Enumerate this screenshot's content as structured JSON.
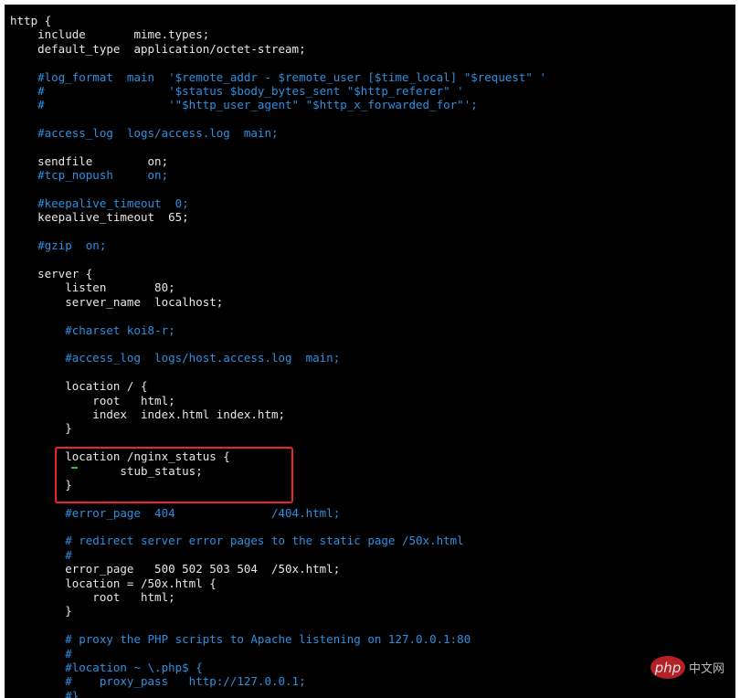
{
  "colors": {
    "background": "#000000",
    "text": "#e6e6e6",
    "comment": "#2f8fe0",
    "highlight": "#e8262a",
    "cursor": "#22c83a"
  },
  "lines": [
    {
      "text": "http {",
      "comment": false
    },
    {
      "text": "    include       mime.types;",
      "comment": false
    },
    {
      "text": "    default_type  application/octet-stream;",
      "comment": false
    },
    {
      "text": "",
      "comment": false
    },
    {
      "text": "    #log_format  main  '$remote_addr - $remote_user [$time_local] \"$request\" '",
      "comment": true
    },
    {
      "text": "    #                  '$status $body_bytes_sent \"$http_referer\" '",
      "comment": true
    },
    {
      "text": "    #                  '\"$http_user_agent\" \"$http_x_forwarded_for\"';",
      "comment": true
    },
    {
      "text": "",
      "comment": false
    },
    {
      "text": "    #access_log  logs/access.log  main;",
      "comment": true
    },
    {
      "text": "",
      "comment": false
    },
    {
      "text": "    sendfile        on;",
      "comment": false
    },
    {
      "text": "    #tcp_nopush     on;",
      "comment": true
    },
    {
      "text": "",
      "comment": false
    },
    {
      "text": "    #keepalive_timeout  0;",
      "comment": true
    },
    {
      "text": "    keepalive_timeout  65;",
      "comment": false
    },
    {
      "text": "",
      "comment": false
    },
    {
      "text": "    #gzip  on;",
      "comment": true
    },
    {
      "text": "",
      "comment": false
    },
    {
      "text": "    server {",
      "comment": false
    },
    {
      "text": "        listen       80;",
      "comment": false
    },
    {
      "text": "        server_name  localhost;",
      "comment": false
    },
    {
      "text": "",
      "comment": false
    },
    {
      "text": "        #charset koi8-r;",
      "comment": true
    },
    {
      "text": "",
      "comment": false
    },
    {
      "text": "        #access_log  logs/host.access.log  main;",
      "comment": true
    },
    {
      "text": "",
      "comment": false
    },
    {
      "text": "        location / {",
      "comment": false
    },
    {
      "text": "            root   html;",
      "comment": false
    },
    {
      "text": "            index  index.html index.htm;",
      "comment": false
    },
    {
      "text": "        }",
      "comment": false
    },
    {
      "text": "",
      "comment": false
    },
    {
      "text": "        location /nginx_status {",
      "comment": false
    },
    {
      "text": "                stub_status;",
      "comment": false
    },
    {
      "text": "        }",
      "comment": false
    },
    {
      "text": "",
      "comment": false
    },
    {
      "text": "        #error_page  404              /404.html;",
      "comment": true
    },
    {
      "text": "",
      "comment": false
    },
    {
      "text": "        # redirect server error pages to the static page /50x.html",
      "comment": true
    },
    {
      "text": "        #",
      "comment": true
    },
    {
      "text": "        error_page   500 502 503 504  /50x.html;",
      "comment": false
    },
    {
      "text": "        location = /50x.html {",
      "comment": false
    },
    {
      "text": "            root   html;",
      "comment": false
    },
    {
      "text": "        }",
      "comment": false
    },
    {
      "text": "",
      "comment": false
    },
    {
      "text": "        # proxy the PHP scripts to Apache listening on 127.0.0.1:80",
      "comment": true
    },
    {
      "text": "        #",
      "comment": true
    },
    {
      "text": "        #location ~ \\.php$ {",
      "comment": true
    },
    {
      "text": "        #    proxy_pass   http://127.0.0.1;",
      "comment": true
    },
    {
      "text": "        #}",
      "comment": true
    }
  ],
  "watermark": {
    "logo": "php",
    "text": "中文网"
  }
}
